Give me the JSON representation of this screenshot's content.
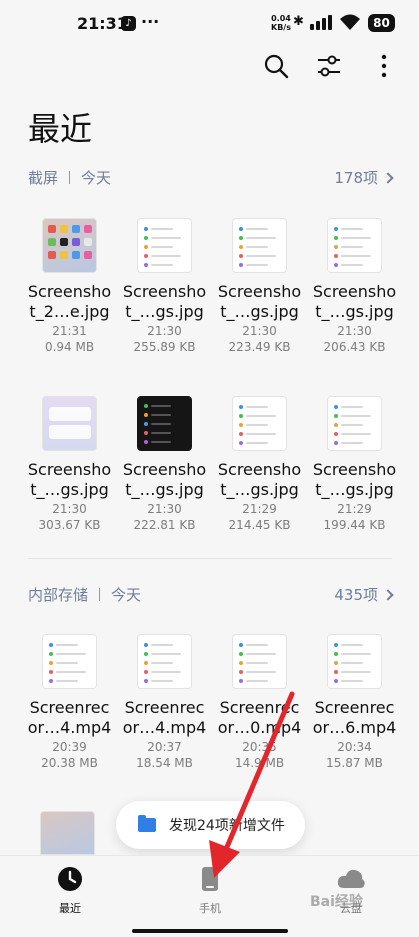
{
  "status_bar": {
    "time": "21:31",
    "net_speed_value": "0.04",
    "net_speed_unit": "KB/s",
    "battery": "80"
  },
  "toolbar": {
    "search_icon": "search-icon",
    "filter_icon": "sliders-icon",
    "more_icon": "more-vertical-icon"
  },
  "page": {
    "title": "最近"
  },
  "sections": [
    {
      "source": "截屏",
      "day": "今天",
      "count": "178项",
      "items": [
        {
          "name_line1": "Screensho",
          "name_line2": "t_2…e.jpg",
          "time": "21:31",
          "size": "0.94 MB",
          "thumb": "home"
        },
        {
          "name_line1": "Screensho",
          "name_line2": "t_…gs.jpg",
          "time": "21:30",
          "size": "255.89 KB",
          "thumb": "settings"
        },
        {
          "name_line1": "Screensho",
          "name_line2": "t_…gs.jpg",
          "time": "21:30",
          "size": "223.49 KB",
          "thumb": "settings"
        },
        {
          "name_line1": "Screensho",
          "name_line2": "t_…gs.jpg",
          "time": "21:30",
          "size": "206.43 KB",
          "thumb": "settings"
        },
        {
          "name_line1": "Screensho",
          "name_line2": "t_…gs.jpg",
          "time": "21:30",
          "size": "303.67 KB",
          "thumb": "purple"
        },
        {
          "name_line1": "Screensho",
          "name_line2": "t_…gs.jpg",
          "time": "21:30",
          "size": "222.81 KB",
          "thumb": "dark"
        },
        {
          "name_line1": "Screensho",
          "name_line2": "t_…gs.jpg",
          "time": "21:29",
          "size": "214.45 KB",
          "thumb": "settings"
        },
        {
          "name_line1": "Screensho",
          "name_line2": "t_…gs.jpg",
          "time": "21:29",
          "size": "199.44 KB",
          "thumb": "settings"
        }
      ]
    },
    {
      "source": "内部存储",
      "day": "今天",
      "count": "435项",
      "items": [
        {
          "name_line1": "Screenrec",
          "name_line2": "or…4.mp4",
          "time": "20:39",
          "size": "20.38 MB",
          "thumb": "settings"
        },
        {
          "name_line1": "Screenrec",
          "name_line2": "or…4.mp4",
          "time": "20:37",
          "size": "18.54 MB",
          "thumb": "settings"
        },
        {
          "name_line1": "Screenrec",
          "name_line2": "or…0.mp4",
          "time": "20:35",
          "size": "14.9 MB",
          "thumb": "settings"
        },
        {
          "name_line1": "Screenrec",
          "name_line2": "or…6.mp4",
          "time": "20:34",
          "size": "15.87 MB",
          "thumb": "settings"
        }
      ]
    }
  ],
  "toast": {
    "text": "发现24项新增文件"
  },
  "bottom_nav": [
    {
      "label": "最近",
      "icon": "clock-icon",
      "active": true
    },
    {
      "label": "手机",
      "icon": "phone-icon",
      "active": false
    },
    {
      "label": "云盘",
      "icon": "cloud-icon",
      "active": false
    }
  ],
  "watermark": "Bai经验",
  "colors": {
    "accent_blue": "#2f7fe6",
    "annotation_arrow": "#e3262b",
    "section_header": "#6f7f99"
  }
}
